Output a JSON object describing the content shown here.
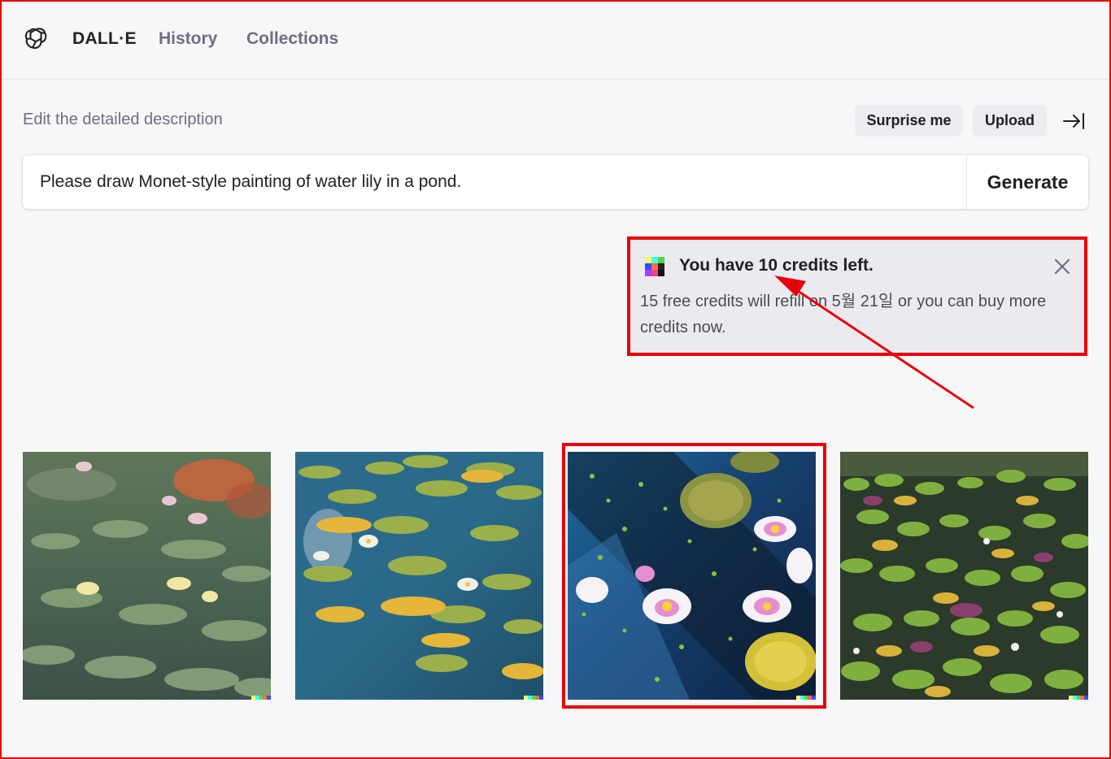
{
  "header": {
    "brand": "DALL·E",
    "nav": [
      {
        "label": "History"
      },
      {
        "label": "Collections"
      }
    ],
    "logo_icon": "openai-logo-icon"
  },
  "prompt": {
    "label": "Edit the detailed description",
    "surprise_label": "Surprise me",
    "upload_label": "Upload",
    "collapse_icon": "arrow-right-to-bar-icon",
    "value": "Please draw Monet-style painting of water lily in a pond.",
    "generate_label": "Generate"
  },
  "credits": {
    "title": "You have 10 credits left.",
    "body": "15 free credits will refill on 5월 21일 or you can buy more credits now.",
    "icon": "dalle-color-grid-icon",
    "close_icon": "close-icon"
  },
  "images": [
    {
      "name": "water-lily-image-1"
    },
    {
      "name": "water-lily-image-2"
    },
    {
      "name": "water-lily-image-3"
    },
    {
      "name": "water-lily-image-4"
    }
  ],
  "colors": {
    "annotation_red": "#e8000b",
    "background": "#f7f7f8",
    "muted_text": "#6e6e80",
    "pill_bg": "#ececf1"
  }
}
